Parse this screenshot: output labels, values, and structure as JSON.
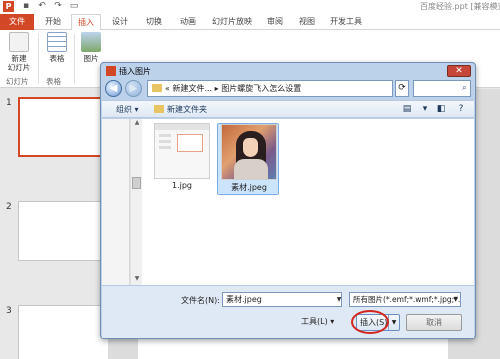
{
  "app": {
    "document_title": "百度经验.ppt [兼容模式]",
    "logo_letter": "P"
  },
  "quick_access": {
    "icons": [
      "save-icon",
      "undo-icon",
      "redo-icon",
      "slideshow-icon"
    ]
  },
  "ribbon": {
    "tabs": [
      "文件",
      "开始",
      "插入",
      "设计",
      "切换",
      "动画",
      "幻灯片放映",
      "审阅",
      "视图",
      "开发工具"
    ],
    "active_tab": "插入",
    "new_slide_label": "新建\n幻灯片",
    "table_label": "表格",
    "picture_label": "图片",
    "groups": [
      "幻灯片",
      "表格"
    ]
  },
  "slides": {
    "numbers": [
      "1",
      "2",
      "3"
    ]
  },
  "dialog": {
    "title": "插入图片",
    "close_glyph": "✕",
    "address": {
      "prefix": "«",
      "segments": [
        "新建文件...",
        "图片螺旋飞入怎么设置"
      ],
      "separator": "▸",
      "search_icon": "search-icon"
    },
    "commands": {
      "organize": "组织 ▾",
      "new_folder": "新建文件夹"
    },
    "files": [
      {
        "name": "1.jpg",
        "selected": false,
        "thumbnail": "ppt-screenshot"
      },
      {
        "name": "素材.jpeg",
        "selected": true,
        "thumbnail": "artwork-portrait"
      }
    ],
    "footer": {
      "filename_label": "文件名(N):",
      "filename_value": "素材.jpeg",
      "filetype_value": "所有图片(*.emf;*.wmf;*.jpg;*.j",
      "tools_label": "工具(L)",
      "insert_label": "插入(S)",
      "cancel_label": "取消"
    }
  }
}
